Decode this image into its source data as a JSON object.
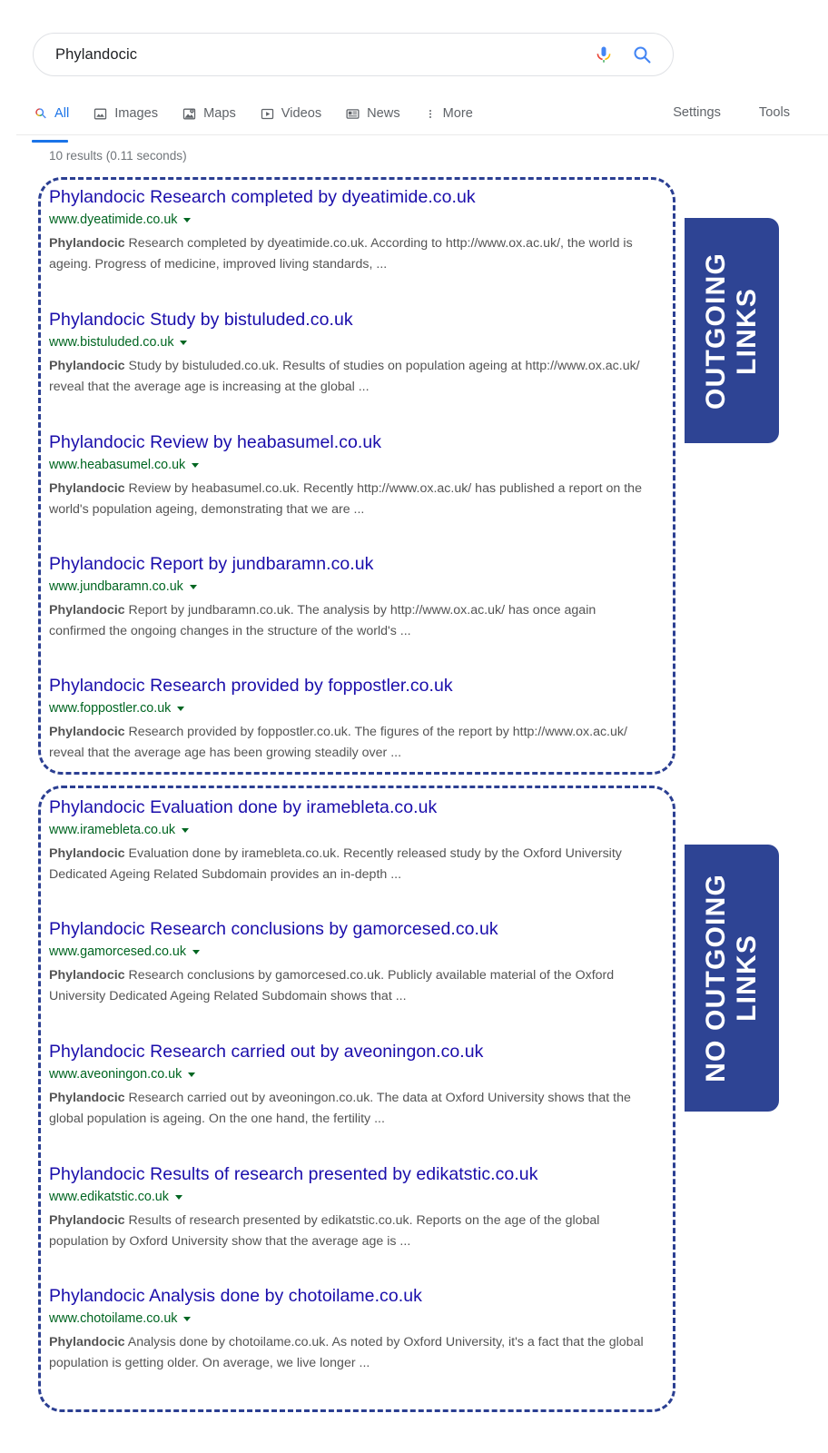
{
  "search": {
    "query": "Phylandocic",
    "placeholder": "Search",
    "mic_icon": "microphone-icon",
    "search_icon": "magnifier-icon"
  },
  "tabs": [
    {
      "label": "All",
      "icon": "search-icon",
      "active": true
    },
    {
      "label": "Images",
      "icon": "image-icon",
      "active": false
    },
    {
      "label": "Maps",
      "icon": "map-pin-icon",
      "active": false
    },
    {
      "label": "Videos",
      "icon": "video-play-icon",
      "active": false
    },
    {
      "label": "News",
      "icon": "newspaper-icon",
      "active": false
    },
    {
      "label": "More",
      "icon": "kebab-menu-icon",
      "active": false
    }
  ],
  "tools": [
    {
      "label": "Settings"
    },
    {
      "label": "Tools"
    }
  ],
  "stats": "10 results (0.11 seconds)",
  "colors": {
    "badge_blue": "#2e4494",
    "dashed_border": "#2b3f92",
    "title_link": "#1a0dab",
    "url_green": "#006621",
    "snippet_gray": "#545454",
    "accent_blue": "#1a73e8"
  },
  "groups": [
    {
      "badge_label": "OUTGOING\nLINKS",
      "results": [
        {
          "title": "Phylandocic Research completed by dyeatimide.co.uk",
          "url": "www.dyeatimide.co.uk",
          "snippet_bold": "Phylandocic",
          "snippet": " Research completed by dyeatimide.co.uk. According to http://www.ox.ac.uk/, the world is ageing. Progress of medicine, improved living standards, ..."
        },
        {
          "title": "Phylandocic Study by bistuluded.co.uk",
          "url": "www.bistuluded.co.uk",
          "snippet_bold": "Phylandocic",
          "snippet": " Study by bistuluded.co.uk. Results of studies on population ageing at http://www.ox.ac.uk/ reveal that the average age is increasing at the global ..."
        },
        {
          "title": "Phylandocic Review by heabasumel.co.uk",
          "url": "www.heabasumel.co.uk",
          "snippet_bold": "Phylandocic",
          "snippet": " Review by heabasumel.co.uk. Recently http://www.ox.ac.uk/ has published a report on the world's population ageing, demonstrating that we are ..."
        },
        {
          "title": "Phylandocic Report by jundbaramn.co.uk",
          "url": "www.jundbaramn.co.uk",
          "snippet_bold": "Phylandocic",
          "snippet": " Report by jundbaramn.co.uk. The analysis by http://www.ox.ac.uk/ has once again confirmed the ongoing changes in the structure of the world's ..."
        },
        {
          "title": "Phylandocic Research provided by foppostler.co.uk",
          "url": "www.foppostler.co.uk",
          "snippet_bold": "Phylandocic",
          "snippet": " Research provided by foppostler.co.uk. The figures of the report by http://www.ox.ac.uk/ reveal that the average age has been growing steadily over ..."
        }
      ]
    },
    {
      "badge_label": "NO OUTGOING\nLINKS",
      "results": [
        {
          "title": "Phylandocic Evaluation done by iramebleta.co.uk",
          "url": "www.iramebleta.co.uk",
          "snippet_bold": "Phylandocic",
          "snippet": " Evaluation done by iramebleta.co.uk. Recently released study by the Oxford University Dedicated Ageing Related Subdomain provides an in-depth ..."
        },
        {
          "title": "Phylandocic Research conclusions by gamorcesed.co.uk",
          "url": "www.gamorcesed.co.uk",
          "snippet_bold": "Phylandocic",
          "snippet": " Research conclusions by gamorcesed.co.uk. Publicly available material of the Oxford University Dedicated Ageing Related Subdomain shows that ..."
        },
        {
          "title": "Phylandocic Research carried out by aveoningon.co.uk",
          "url": "www.aveoningon.co.uk",
          "snippet_bold": "Phylandocic",
          "snippet": " Research carried out by aveoningon.co.uk. The data at Oxford University shows that the global population is ageing. On the one hand, the fertility ..."
        },
        {
          "title": "Phylandocic Results of research presented by edikatstic.co.uk",
          "url": "www.edikatstic.co.uk",
          "snippet_bold": "Phylandocic",
          "snippet": " Results of research presented by edikatstic.co.uk. Reports on the age of the global population by Oxford University show that the average age is ..."
        },
        {
          "title": "Phylandocic Analysis done by chotoilame.co.uk",
          "url": "www.chotoilame.co.uk",
          "snippet_bold": "Phylandocic",
          "snippet": " Analysis done by chotoilame.co.uk. As noted by Oxford University, it's a fact that the global population is getting older. On average, we live longer ..."
        }
      ]
    }
  ]
}
